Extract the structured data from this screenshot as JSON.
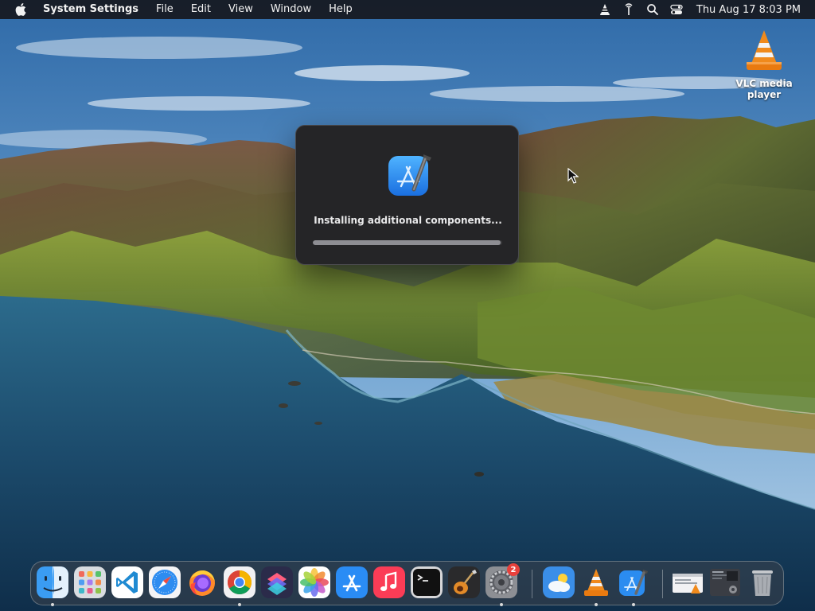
{
  "menubar": {
    "app_name": "System Settings",
    "menus": [
      "File",
      "Edit",
      "View",
      "Window",
      "Help"
    ],
    "status_icons": [
      "vlc-icon",
      "antenna-icon",
      "search-icon",
      "control-center-icon"
    ],
    "clock": "Thu Aug 17  8:03 PM"
  },
  "desktop": {
    "icons": [
      {
        "label": "VLC media player",
        "icon": "vlc-cone-icon"
      }
    ]
  },
  "dialog": {
    "icon": "xcode-icon",
    "message": "Installing additional components...",
    "progress": 0.99
  },
  "dock": {
    "apps": [
      {
        "name": "Finder",
        "icon": "finder-icon",
        "running": true
      },
      {
        "name": "Launchpad",
        "icon": "launchpad-icon",
        "running": false
      },
      {
        "name": "Visual Studio Code",
        "icon": "vscode-icon",
        "running": false
      },
      {
        "name": "Safari",
        "icon": "safari-icon",
        "running": false
      },
      {
        "name": "Firefox",
        "icon": "firefox-icon",
        "running": false
      },
      {
        "name": "Google Chrome",
        "icon": "chrome-icon",
        "running": true
      },
      {
        "name": "Shortcuts",
        "icon": "shortcuts-icon",
        "running": false
      },
      {
        "name": "Photos",
        "icon": "photos-icon",
        "running": false
      },
      {
        "name": "App Store",
        "icon": "app-store-icon",
        "running": false
      },
      {
        "name": "Music",
        "icon": "music-icon",
        "running": false
      },
      {
        "name": "Terminal",
        "icon": "terminal-icon",
        "running": false
      },
      {
        "name": "GarageBand",
        "icon": "garageband-icon",
        "running": false
      },
      {
        "name": "System Settings",
        "icon": "settings-gear-icon",
        "running": true,
        "badge": "2"
      }
    ],
    "recent_apps": [
      {
        "name": "Weather",
        "icon": "weather-icon",
        "running": false
      },
      {
        "name": "VLC",
        "icon": "vlc-cone-icon",
        "running": true
      },
      {
        "name": "Xcode",
        "icon": "xcode-icon",
        "running": true
      }
    ],
    "right_items": [
      {
        "name": "Downloads stack",
        "icon": "downloads-stack-icon"
      },
      {
        "name": "Screenshots stack",
        "icon": "screenshots-stack-icon"
      },
      {
        "name": "Trash",
        "icon": "trash-icon"
      }
    ]
  },
  "colors": {
    "menubar_bg": "#16181e",
    "dialog_bg": "#252527",
    "badge": "#e8413c",
    "sea": "#1b4466",
    "sky": "#5a8fc4"
  }
}
